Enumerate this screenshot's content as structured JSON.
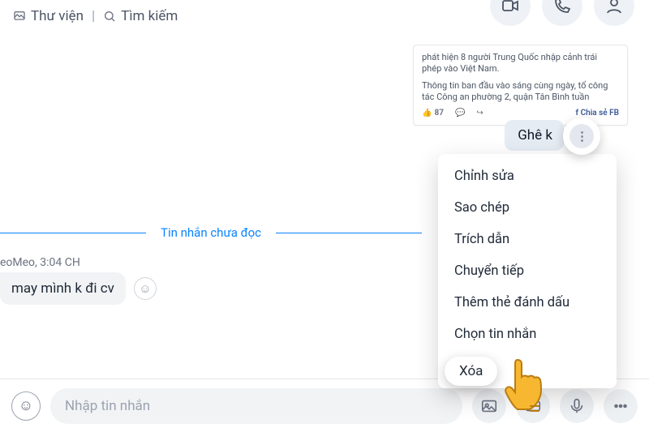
{
  "top": {
    "library": "Thư viện",
    "search": "Tìm kiếm"
  },
  "card": {
    "p1": "phát hiện 8 người Trung Quốc nhập cảnh trái phép vào Việt Nam.",
    "p2": "Thông tin ban đầu vào sáng cùng ngày, tổ công tác Công an phường 2, quận Tân Bình tuần",
    "like": "87",
    "comment": "",
    "share": ""
  },
  "own_msg": "Ghê k",
  "menu": {
    "items": [
      "Chỉnh sửa",
      "Sao chép",
      "Trích dẫn",
      "Chuyển tiếp",
      "Thêm thẻ đánh dấu",
      "Chọn tin nhắn",
      "Xóa"
    ]
  },
  "pill": "Xóa",
  "divider": "Tin nhắn chưa đọc",
  "meta": "eoMeo, 3:04 CH",
  "in_msg": "may mình k đi cv",
  "composer": {
    "placeholder": "Nhập tin nhắn"
  }
}
